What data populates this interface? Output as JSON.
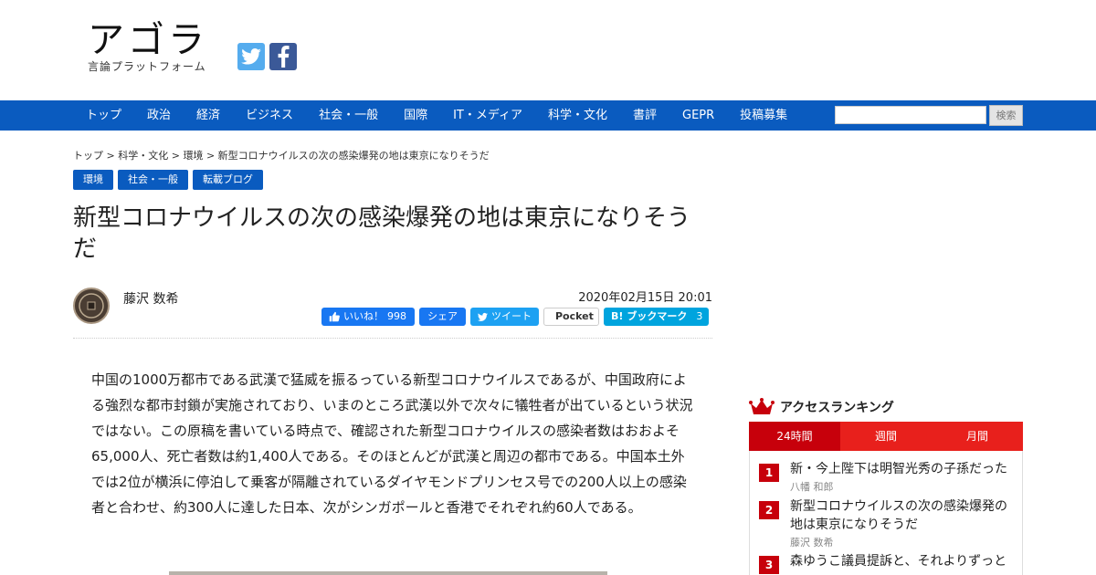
{
  "site": {
    "logo_main": "アゴラ",
    "logo_sub": "言論プラットフォーム"
  },
  "icons": {
    "twitter": "twitter-icon",
    "facebook": "facebook-icon",
    "crown": "crown-icon"
  },
  "colors": {
    "nav_bg": "#0a5bbf",
    "ranking_red": "#c7000b",
    "ranking_tab": "#e8201c"
  },
  "nav": {
    "items": [
      "トップ",
      "政治",
      "経済",
      "ビジネス",
      "社会・一般",
      "国際",
      "IT・メディア",
      "科学・文化",
      "書評",
      "GEPR",
      "投稿募集"
    ],
    "search_placeholder": "",
    "search_label": "検索"
  },
  "breadcrumb": {
    "items": [
      "トップ",
      "科学・文化",
      "環境",
      "新型コロナウイルスの次の感染爆発の地は東京になりそうだ"
    ],
    "separator": ">"
  },
  "article": {
    "tags": [
      "環境",
      "社会・一般",
      "転載ブログ"
    ],
    "title": "新型コロナウイルスの次の感染爆発の地は東京になりそうだ",
    "author": "藤沢 数希",
    "date": "2020年02月15日 20:01",
    "share": {
      "like_label": "いいね！",
      "like_count": "998",
      "share_label": "シェア",
      "tweet_label": "ツイート",
      "pocket_label": "Pocket",
      "hatena_label": "ブックマーク",
      "hatena_count": "3"
    },
    "body": "中国の1000万都市である武漢で猛威を振るっている新型コロナウイルスであるが、中国政府による強烈な都市封鎖が実施されており、いまのところ武漢以外で次々に犠牲者が出ているという状況ではない。この原稿を書いている時点で、確認された新型コロナウイルスの感染者数はおおよそ65,000人、死亡者数は約1,400人である。そのほとんどが武漢と周辺の都市である。中国本土外では2位が横浜に停泊して乗客が隔離されているダイヤモンドプリンセス号での200人以上の感染者と合わせ、約300人に達した日本、次がシンガポールと香港でそれぞれ約60人である。"
  },
  "ranking": {
    "title": "アクセスランキング",
    "tabs": [
      "24時間",
      "週間",
      "月間"
    ],
    "active_tab": "24時間",
    "items": [
      {
        "rank": "1",
        "title": "新・今上陛下は明智光秀の子孫だった",
        "author": "八幡 和郎"
      },
      {
        "rank": "2",
        "title": "新型コロナウイルスの次の感染爆発の地は東京になりそうだ",
        "author": "藤沢 数希"
      },
      {
        "rank": "3",
        "title": "森ゆうこ議員提訴と、それよりずっと",
        "author": ""
      }
    ]
  }
}
